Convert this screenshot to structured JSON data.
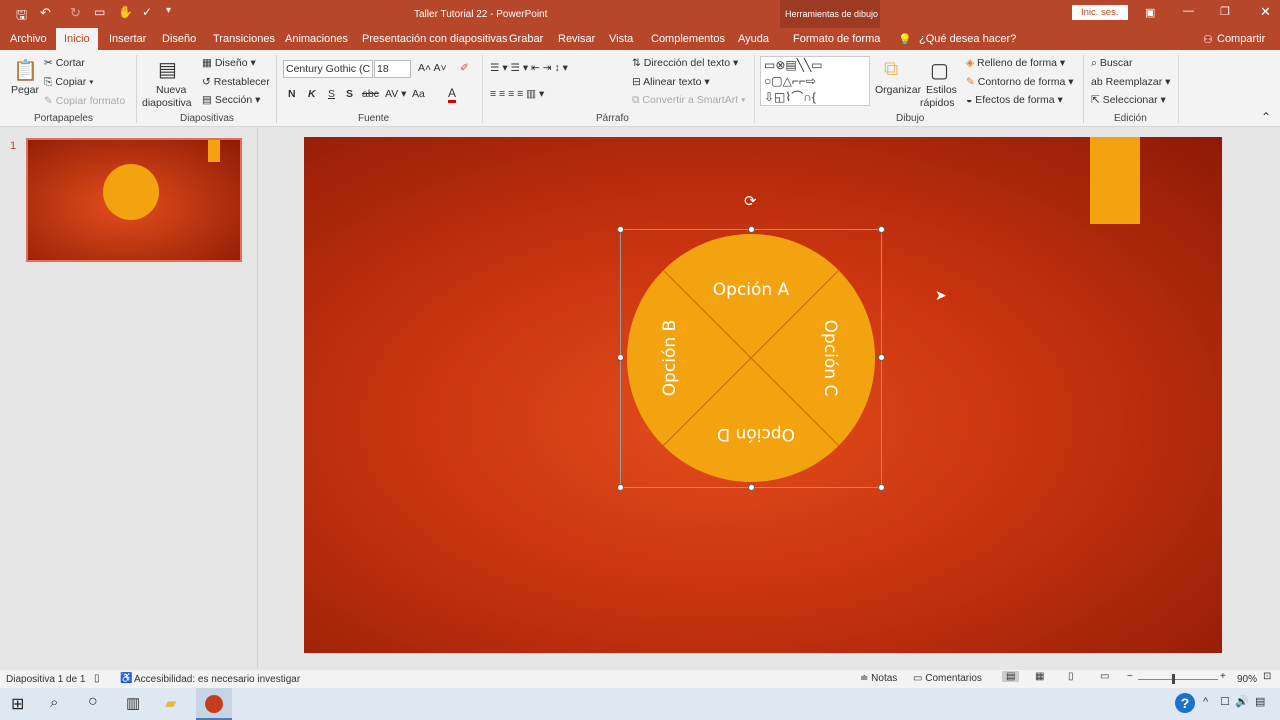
{
  "titlebar": {
    "title": "Taller Tutorial 22  -  PowerPoint",
    "context_tools": "Herramientas de dibujo",
    "signin": "Inic. ses."
  },
  "tabs": [
    "Archivo",
    "Inicio",
    "Insertar",
    "Diseño",
    "Transiciones",
    "Animaciones",
    "Presentación con diapositivas",
    "Grabar",
    "Revisar",
    "Vista",
    "Complementos",
    "Ayuda",
    "Formato de forma"
  ],
  "tellme": "¿Qué desea hacer?",
  "share": "Compartir",
  "ribbon": {
    "clipboard": {
      "paste": "Pegar",
      "cut": "Cortar",
      "copy": "Copiar",
      "format_painter": "Copiar formato",
      "label": "Portapapeles"
    },
    "slides": {
      "new": "Nueva",
      "new2": "diapositiva",
      "layout": "Diseño",
      "reset": "Restablecer",
      "section": "Sección",
      "label": "Diapositivas"
    },
    "font": {
      "name": "Century Gothic (C",
      "size": "18",
      "bold": "N",
      "italic": "K",
      "underline": "S",
      "shadow": "S",
      "strike": "abc",
      "case": "Aa",
      "label": "Fuente"
    },
    "paragraph": {
      "direction": "Dirección del texto",
      "align": "Alinear texto",
      "smartart": "Convertir a SmartArt",
      "label": "Párrafo"
    },
    "drawing": {
      "arrange": "Organizar",
      "styles": "Estilos",
      "styles2": "rápidos",
      "fill": "Relleno de forma",
      "outline": "Contorno de forma",
      "effects": "Efectos de forma",
      "label": "Dibujo"
    },
    "editing": {
      "find": "Buscar",
      "replace": "Reemplazar",
      "select": "Seleccionar",
      "label": "Edición"
    }
  },
  "thumbnail": {
    "number": "1"
  },
  "slide": {
    "options": [
      "Opción A",
      "Opción B",
      "Opción C",
      "Opción D"
    ],
    "circle_color": "#f2a30f"
  },
  "status": {
    "slide": "Diapositiva 1 de 1",
    "accessibility": "Accesibilidad: es necesario investigar",
    "notes": "Notas",
    "comments": "Comentarios",
    "zoom": "90%",
    "zoom_percent": 90
  },
  "colors": {
    "accent": "#b7472a"
  }
}
